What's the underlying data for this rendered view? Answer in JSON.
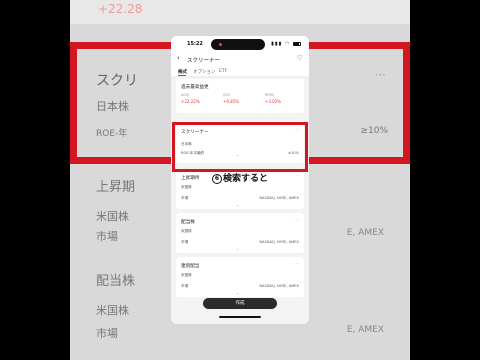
{
  "background": {
    "top_number": "+22.28",
    "card1": {
      "title": "スクリ",
      "market": "日本株",
      "filter": "ROE-年",
      "filter_value": "≥10%"
    },
    "card2": {
      "title": "上昇期",
      "market": "米国株",
      "field": "市場",
      "field_value": "E, AMEX"
    },
    "card3": {
      "title": "配当株",
      "market": "米国株",
      "field": "市場",
      "field_value": "E, AMEX"
    }
  },
  "status_bar": {
    "time": "15:22",
    "signal": "▮▮▮",
    "wifi": "◠",
    "battery_level": 0.8
  },
  "nav": {
    "back": "‹",
    "title": "スクリーナー",
    "heart": "♡"
  },
  "tabs": [
    {
      "label": "株式"
    },
    {
      "label": "オプション"
    },
    {
      "label": "ETF"
    }
  ],
  "cards": {
    "recent": {
      "title": "過去最高益更",
      "metrics": [
        {
          "label": "AGHI",
          "value": "+22.22%"
        },
        {
          "label": "SYD",
          "value": "+9.85%"
        },
        {
          "label": "RRPA",
          "value": "+3.02%"
        }
      ]
    },
    "screener": {
      "title": "スクリーナー",
      "more": "···",
      "market": "日本株",
      "filter_label": "ROE-年次最終",
      "filter_value": "≥10%"
    },
    "uptrend": {
      "title": "上昇期待",
      "more": "···",
      "market": "米国株",
      "field_label": "市場",
      "field_value": "NASDAQ, NYSE, AMEX"
    },
    "dividend": {
      "title": "配当株",
      "more": "···",
      "market": "米国株",
      "field_label": "市場",
      "field_value": "NASDAQ, NYSE, AMEX"
    },
    "consecutive": {
      "title": "連続配当",
      "more": "···",
      "market": "米国株",
      "field_label": "市場",
      "field_value": "NASDAQ, NYSE, AMEX"
    }
  },
  "caption": {
    "number": "6",
    "text": "検索すると"
  },
  "create_button": "作成",
  "colors": {
    "accent": "#d3161f",
    "positive": "#e03535"
  }
}
